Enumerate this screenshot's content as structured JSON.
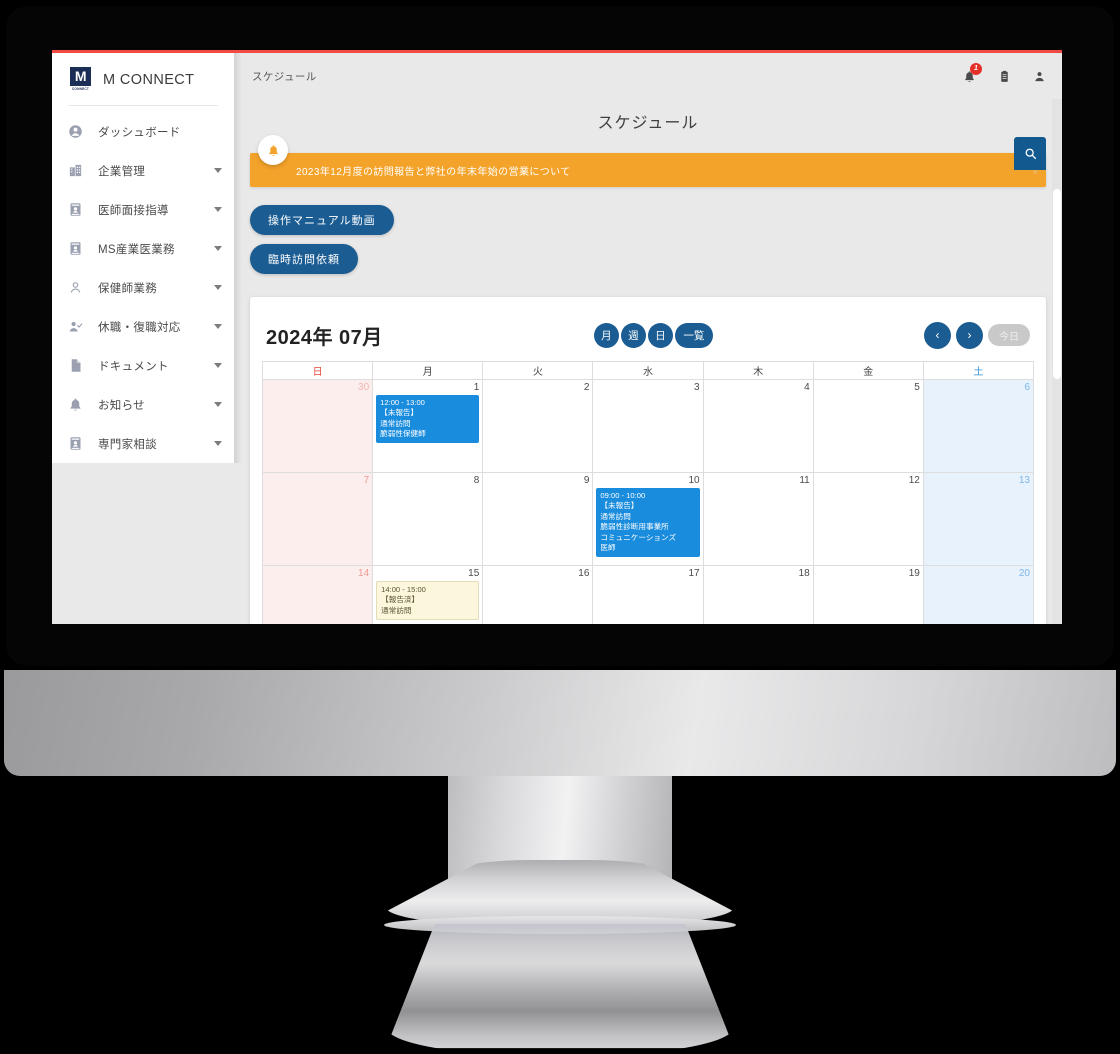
{
  "brand": {
    "name": "M CONNECT",
    "logo_letter": "M",
    "logo_caption": "CONNECT"
  },
  "sidebar": {
    "items": [
      {
        "label": "ダッシュボード",
        "icon": "user-circle-icon",
        "expandable": false
      },
      {
        "label": "企業管理",
        "icon": "building-icon",
        "expandable": true
      },
      {
        "label": "医師面接指導",
        "icon": "id-card-icon",
        "expandable": true
      },
      {
        "label": "MS産業医業務",
        "icon": "id-card-icon",
        "expandable": true
      },
      {
        "label": "保健師業務",
        "icon": "person-icon",
        "expandable": true
      },
      {
        "label": "休職・復職対応",
        "icon": "person-check-icon",
        "expandable": true
      },
      {
        "label": "ドキュメント",
        "icon": "document-icon",
        "expandable": true
      },
      {
        "label": "お知らせ",
        "icon": "bell-icon",
        "expandable": true
      },
      {
        "label": "専門家相談",
        "icon": "id-card-icon",
        "expandable": true
      }
    ]
  },
  "header": {
    "breadcrumb": "スケジュール",
    "page_title": "スケジュール",
    "notification_count": "1",
    "icons": [
      "bell-icon",
      "clipboard-icon",
      "account-icon"
    ]
  },
  "notice": {
    "text": "2023年12月度の訪問報告と弊社の年末年始の営業について",
    "close_label": "×",
    "bell_icon": "bell-icon",
    "background": "#f4a32a"
  },
  "search_fab": {
    "icon": "search-icon",
    "background": "#11598f"
  },
  "actions": [
    {
      "label": "操作マニュアル動画"
    },
    {
      "label": "臨時訪問依頼"
    }
  ],
  "calendar": {
    "month_label": "2024年 07月",
    "view_buttons": [
      {
        "label": "月",
        "wide": false
      },
      {
        "label": "週",
        "wide": false
      },
      {
        "label": "日",
        "wide": false
      },
      {
        "label": "一覧",
        "wide": true
      }
    ],
    "prev_label": "‹",
    "next_label": "›",
    "today_label": "今日",
    "weekdays": [
      "日",
      "月",
      "火",
      "水",
      "木",
      "金",
      "土"
    ],
    "weeks": [
      {
        "days": [
          {
            "num": "30",
            "type": "sun",
            "other_month": true,
            "events": []
          },
          {
            "num": "1",
            "type": "weekday",
            "events": [
              {
                "style": "blue",
                "text": "12:00 - 13:00\n 【未報告】\n通常訪問\n脆弱性保健師"
              }
            ]
          },
          {
            "num": "2",
            "type": "weekday",
            "events": []
          },
          {
            "num": "3",
            "type": "weekday",
            "events": []
          },
          {
            "num": "4",
            "type": "weekday",
            "events": []
          },
          {
            "num": "5",
            "type": "weekday",
            "events": []
          },
          {
            "num": "6",
            "type": "sat",
            "events": []
          }
        ]
      },
      {
        "days": [
          {
            "num": "7",
            "type": "sun",
            "events": []
          },
          {
            "num": "8",
            "type": "weekday",
            "events": []
          },
          {
            "num": "9",
            "type": "weekday",
            "events": []
          },
          {
            "num": "10",
            "type": "weekday",
            "events": [
              {
                "style": "blue",
                "text": "09:00 - 10:00\n 【未報告】\n通常訪問\n脆弱性診断用事業所\nコミュニケーションズ\n医師"
              }
            ]
          },
          {
            "num": "11",
            "type": "weekday",
            "events": []
          },
          {
            "num": "12",
            "type": "weekday",
            "events": []
          },
          {
            "num": "13",
            "type": "sat",
            "events": []
          }
        ]
      },
      {
        "days": [
          {
            "num": "14",
            "type": "sun",
            "events": []
          },
          {
            "num": "15",
            "type": "weekday",
            "events": [
              {
                "style": "cream",
                "text": "14:00 - 15:00\n 【報告済】\n通常訪問"
              }
            ]
          },
          {
            "num": "16",
            "type": "weekday",
            "events": []
          },
          {
            "num": "17",
            "type": "weekday",
            "events": []
          },
          {
            "num": "18",
            "type": "weekday",
            "events": []
          },
          {
            "num": "19",
            "type": "weekday",
            "events": []
          },
          {
            "num": "20",
            "type": "sat",
            "events": []
          }
        ]
      }
    ]
  }
}
